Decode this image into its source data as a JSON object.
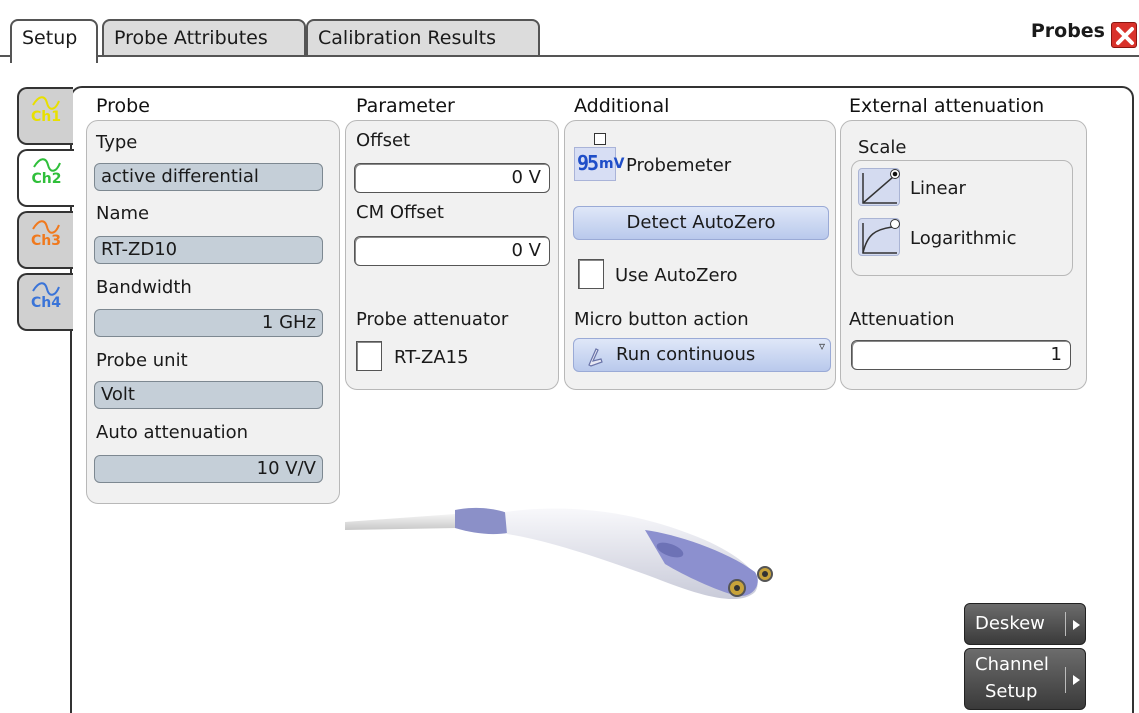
{
  "tabs": [
    {
      "label": "Setup",
      "active": true
    },
    {
      "label": "Probe Attributes",
      "active": false
    },
    {
      "label": "Calibration Results",
      "active": false
    }
  ],
  "window_title": "Probes",
  "channels": [
    {
      "label": "Ch1",
      "color": "#e8e000",
      "active": false
    },
    {
      "label": "Ch2",
      "color": "#2fbf3a",
      "active": true
    },
    {
      "label": "Ch3",
      "color": "#f0791d",
      "active": false
    },
    {
      "label": "Ch4",
      "color": "#3a74d8",
      "active": false
    }
  ],
  "probe": {
    "section_title": "Probe",
    "type_label": "Type",
    "type_value": "active differential",
    "name_label": "Name",
    "name_value": "RT-ZD10",
    "bandwidth_label": "Bandwidth",
    "bandwidth_value": "1 GHz",
    "unit_label": "Probe unit",
    "unit_value": "Volt",
    "auto_att_label": "Auto attenuation",
    "auto_att_value": "10 V/V"
  },
  "parameter": {
    "section_title": "Parameter",
    "offset_label": "Offset",
    "offset_value": "0 V",
    "cm_offset_label": "CM Offset",
    "cm_offset_value": "0 V",
    "attenuator_label": "Probe attenuator",
    "attenuator_value": "RT-ZA15"
  },
  "additional": {
    "section_title": "Additional",
    "probemeter_icon_text": "95",
    "probemeter_icon_unit": "mV",
    "probemeter_label": "Probemeter",
    "detect_autozero_label": "Detect AutoZero",
    "use_autozero_label": "Use AutoZero",
    "micro_button_label": "Micro button action",
    "micro_button_value": "Run continuous"
  },
  "external": {
    "section_title": "External attenuation",
    "scale_label": "Scale",
    "linear_label": "Linear",
    "log_label": "Logarithmic",
    "selected": "Linear",
    "attenuation_label": "Attenuation",
    "attenuation_value": "1"
  },
  "buttons": {
    "deskew": "Deskew",
    "channel_setup_1": "Channel",
    "channel_setup_2": "Setup"
  }
}
